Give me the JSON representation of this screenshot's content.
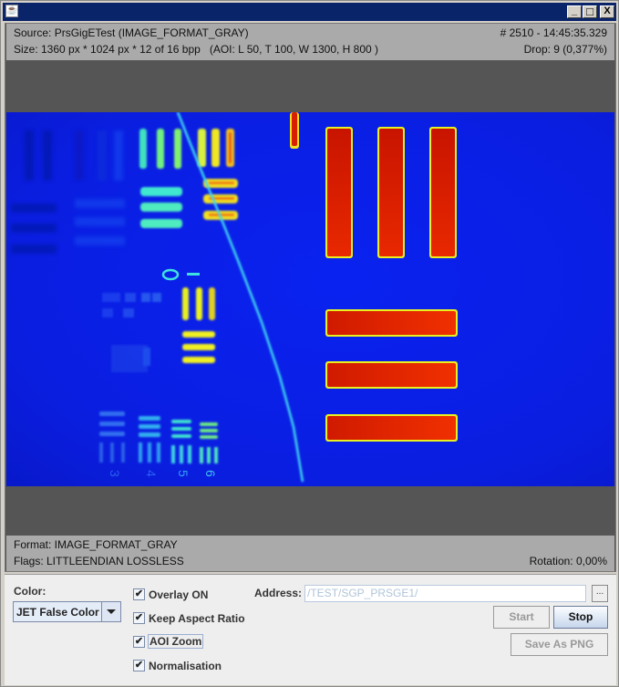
{
  "window": {
    "title": "",
    "buttons": {
      "minimize": "_",
      "maximize": "□",
      "close": "X"
    }
  },
  "info_top": {
    "source": "Source: PrsGigETest (IMAGE_FORMAT_GRAY)",
    "frame_time": "# 2510 - 14:45:35.329",
    "size": "Size: 1360 px * 1024 px * 12 of 16 bpp   (AOI: L 50, T 100, W 1300, H 800 )",
    "drop": "Drop: 9 (0,377%)"
  },
  "info_bottom": {
    "format": "Format: IMAGE_FORMAT_GRAY",
    "flags": "Flags: LITTLEENDIAN LOSSLESS",
    "rotation": "Rotation: 0,00%"
  },
  "image": {
    "description": "USAF resolution test target rendered in JET false color",
    "colormap": "JET",
    "group_labels": [
      "3",
      "4",
      "5",
      "6"
    ],
    "colors": {
      "background": "#0a1ee0",
      "hot": "#e01a00",
      "warm": "#f0e000",
      "edge": "#40f0f0"
    }
  },
  "controls": {
    "color_label": "Color:",
    "color_value": "JET False Color",
    "checkboxes": [
      {
        "label": "Overlay ON",
        "checked": true
      },
      {
        "label": "Keep Aspect Ratio",
        "checked": true
      },
      {
        "label": "AOI Zoom",
        "checked": true
      },
      {
        "label": "Normalisation",
        "checked": true
      }
    ],
    "address_label": "Address:",
    "address_value": "/TEST/SGP_PRSGE1/",
    "browse_label": "...",
    "start_label": "Start",
    "stop_label": "Stop",
    "save_label": "Save As PNG"
  }
}
